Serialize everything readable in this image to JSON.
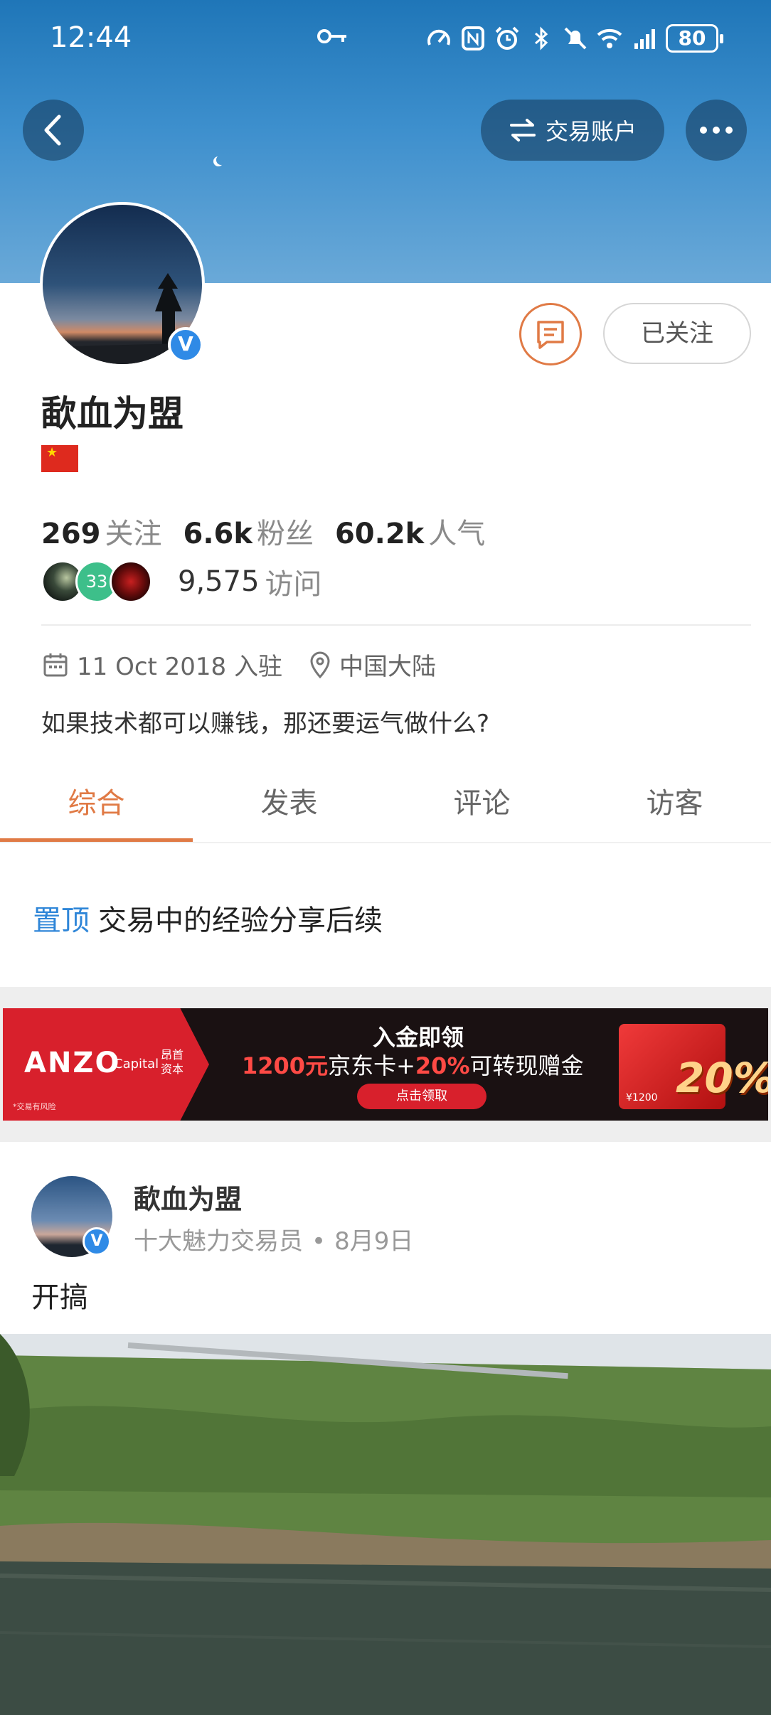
{
  "status_bar": {
    "time": "12:44",
    "battery": "80",
    "icons": [
      "key-icon",
      "speedometer-icon",
      "nfc-icon",
      "alarm-icon",
      "bluetooth-icon",
      "mute-icon",
      "wifi-icon",
      "4g-signal-icon"
    ]
  },
  "header": {
    "trade_account_label": "交易账户"
  },
  "profile": {
    "name": "歃血为盟",
    "follow_label": "已关注",
    "stats": [
      {
        "num": "269",
        "label": "关注"
      },
      {
        "num": "6.6k",
        "label": "粉丝"
      },
      {
        "num": "60.2k",
        "label": "人气"
      }
    ],
    "visitor_badge": "33",
    "visits_count": "9,575",
    "visits_label": "访问",
    "joined": "11 Oct 2018 入驻",
    "location": "中国大陆",
    "bio": "如果技术都可以赚钱，那还要运气做什么?"
  },
  "tabs": [
    {
      "label": "综合",
      "active": true
    },
    {
      "label": "发表",
      "active": false
    },
    {
      "label": "评论",
      "active": false
    },
    {
      "label": "访客",
      "active": false
    }
  ],
  "pinned": {
    "tag": "置顶",
    "title": "交易中的经验分享后续"
  },
  "ad": {
    "brand": "ANZO",
    "brand_sub": "Capital",
    "brand_cn": "昂首资本",
    "risk_note": "*交易有风险",
    "headline": "入金即领",
    "offer_amount": "1200元",
    "offer_mid": "京东卡+",
    "offer_pct": "20%",
    "offer_tail": "可转现赠金",
    "cta": "点击领取",
    "card_value": "¥1200",
    "badge": "20%"
  },
  "post": {
    "author": "歃血为盟",
    "author_title": "十大魅力交易员",
    "separator": "•",
    "date": "8月9日",
    "text": "开搞"
  }
}
